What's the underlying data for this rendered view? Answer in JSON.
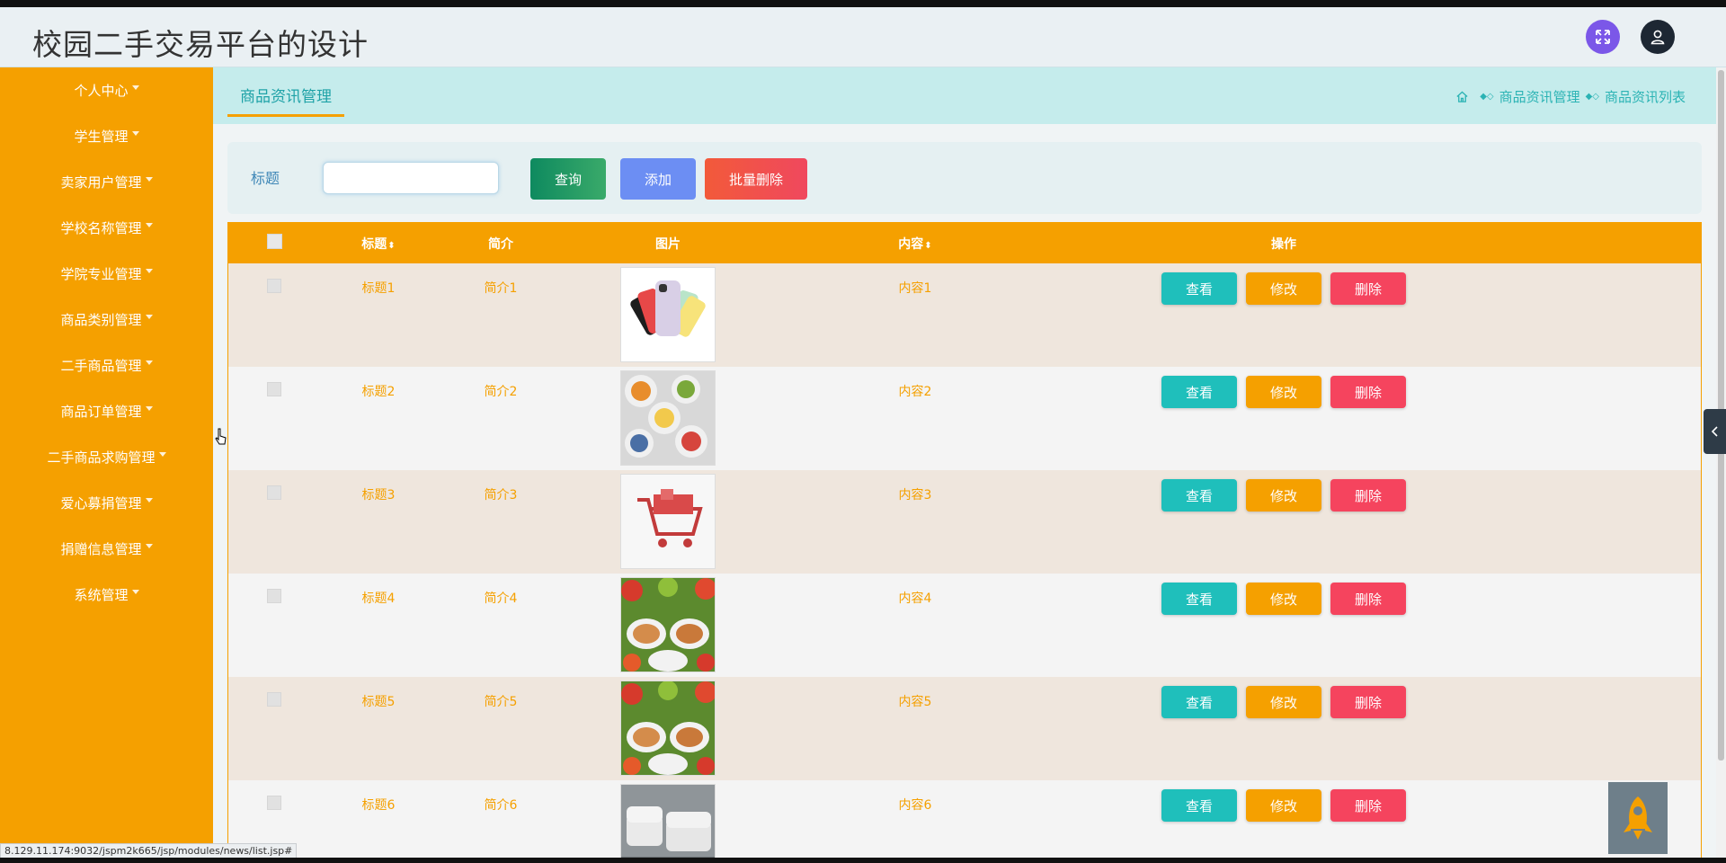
{
  "app": {
    "title": "校园二手交易平台的设计"
  },
  "header": {
    "fullscreen_icon": "expand-icon",
    "user_icon": "user-icon",
    "colors": {
      "fullscreen_bg": "#7b57e8",
      "user_bg": "#1d2733"
    }
  },
  "sidebar": {
    "bg": "#f5a000",
    "items": [
      {
        "label": "个人中心"
      },
      {
        "label": "学生管理"
      },
      {
        "label": "卖家用户管理"
      },
      {
        "label": "学校名称管理"
      },
      {
        "label": "学院专业管理"
      },
      {
        "label": "商品类别管理"
      },
      {
        "label": "二手商品管理"
      },
      {
        "label": "商品订单管理"
      },
      {
        "label": "二手商品求购管理"
      },
      {
        "label": "爱心募捐管理"
      },
      {
        "label": "捐赠信息管理"
      },
      {
        "label": "系统管理"
      }
    ]
  },
  "tabbar": {
    "active_tab": "商品资讯管理",
    "breadcrumb": [
      "商品资讯管理",
      "商品资讯列表"
    ]
  },
  "search": {
    "label": "标题",
    "value": "",
    "placeholder": "",
    "query_label": "查询",
    "add_label": "添加",
    "bulk_delete_label": "批量删除"
  },
  "table": {
    "headers": {
      "title": "标题",
      "intro": "简介",
      "image": "图片",
      "content": "内容",
      "actions": "操作"
    },
    "rows": [
      {
        "title": "标题1",
        "intro": "简介1",
        "image": "phones-photo",
        "content": "内容1"
      },
      {
        "title": "标题2",
        "intro": "简介2",
        "image": "food-bowls-photo",
        "content": "内容2"
      },
      {
        "title": "标题3",
        "intro": "简介3",
        "image": "shopping-cart-photo",
        "content": "内容3"
      },
      {
        "title": "标题4",
        "intro": "简介4",
        "image": "salad-photo",
        "content": "内容4"
      },
      {
        "title": "标题5",
        "intro": "简介5",
        "image": "salad-photo",
        "content": "内容5"
      },
      {
        "title": "标题6",
        "intro": "简介6",
        "image": "sofa-photo",
        "content": "内容6"
      }
    ],
    "row_actions": {
      "view": "查看",
      "edit": "修改",
      "delete": "删除"
    }
  },
  "status_bar": {
    "url": "8.129.11.174:9032/jspm2k665/jsp/modules/news/list.jsp#"
  }
}
